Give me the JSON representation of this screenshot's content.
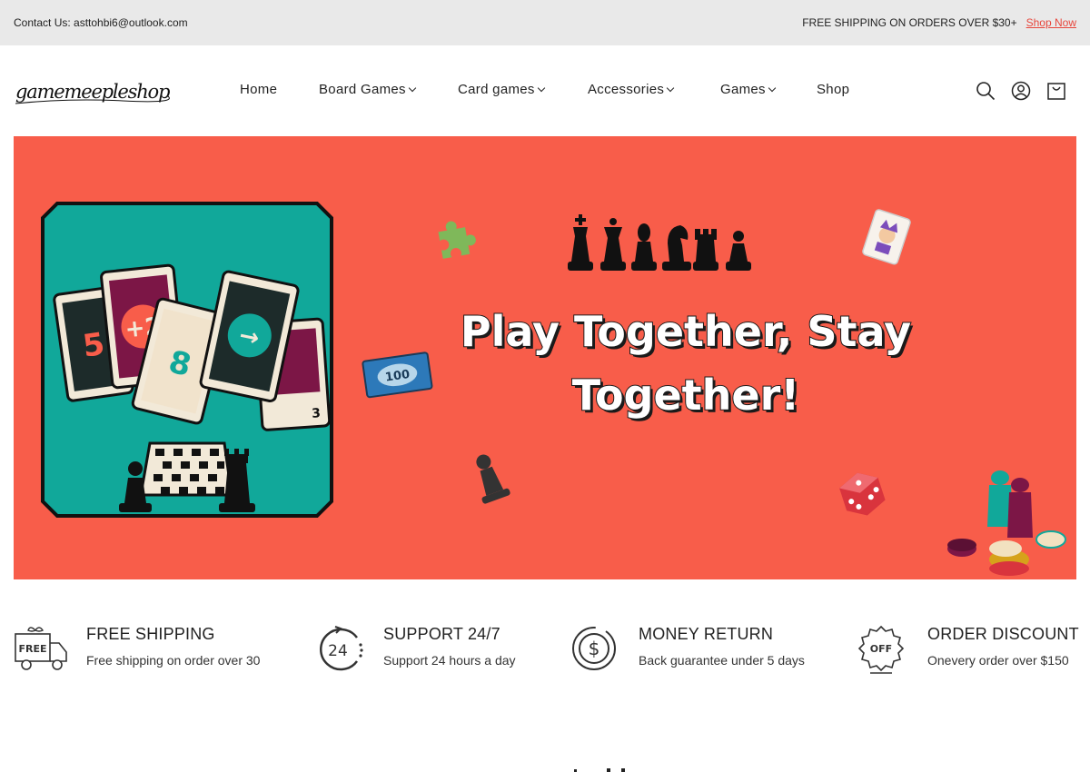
{
  "topbar": {
    "contact": "Contact Us: asttohbi6@outlook.com",
    "promo": "FREE SHIPPING ON ORDERS OVER $30+",
    "shop_now": "Shop Now"
  },
  "header": {
    "logo_text": "gamemeepleshop",
    "nav": [
      {
        "label": "Home",
        "has_dropdown": false
      },
      {
        "label": "Board Games",
        "has_dropdown": true
      },
      {
        "label": "Card games",
        "has_dropdown": true
      },
      {
        "label": "Accessories",
        "has_dropdown": true
      },
      {
        "label": "Games",
        "has_dropdown": true
      },
      {
        "label": "Shop",
        "has_dropdown": false
      }
    ],
    "icons": [
      "search-icon",
      "account-icon",
      "cart-icon"
    ]
  },
  "hero": {
    "headline": "Play Together, Stay Together!",
    "headline_line1": "Play Together, Stay",
    "headline_line2": "Together!",
    "card_labels": [
      "5",
      "+2",
      "8",
      "→",
      "3"
    ],
    "bill_label": "100",
    "background_color": "#f85d4a",
    "panel_color": "#11a89a"
  },
  "features": [
    {
      "icon": "free-shipping-truck-icon",
      "icon_text": "FREE",
      "title": "FREE SHIPPING",
      "subtitle": "Free shipping on order over 30"
    },
    {
      "icon": "support-24-icon",
      "icon_text": "24",
      "title": "SUPPORT 24/7",
      "subtitle": "Support 24 hours a day"
    },
    {
      "icon": "money-return-icon",
      "icon_text": "$",
      "title": "MONEY RETURN",
      "subtitle": "Back guarantee under 5 days"
    },
    {
      "icon": "order-discount-icon",
      "icon_text": "OFF",
      "title": "ORDER DISCOUNT",
      "subtitle": "Onevery order over $150"
    }
  ],
  "colors": {
    "accent": "#e8463c",
    "topbar_bg": "#e9e9e9",
    "text": "#222222"
  }
}
